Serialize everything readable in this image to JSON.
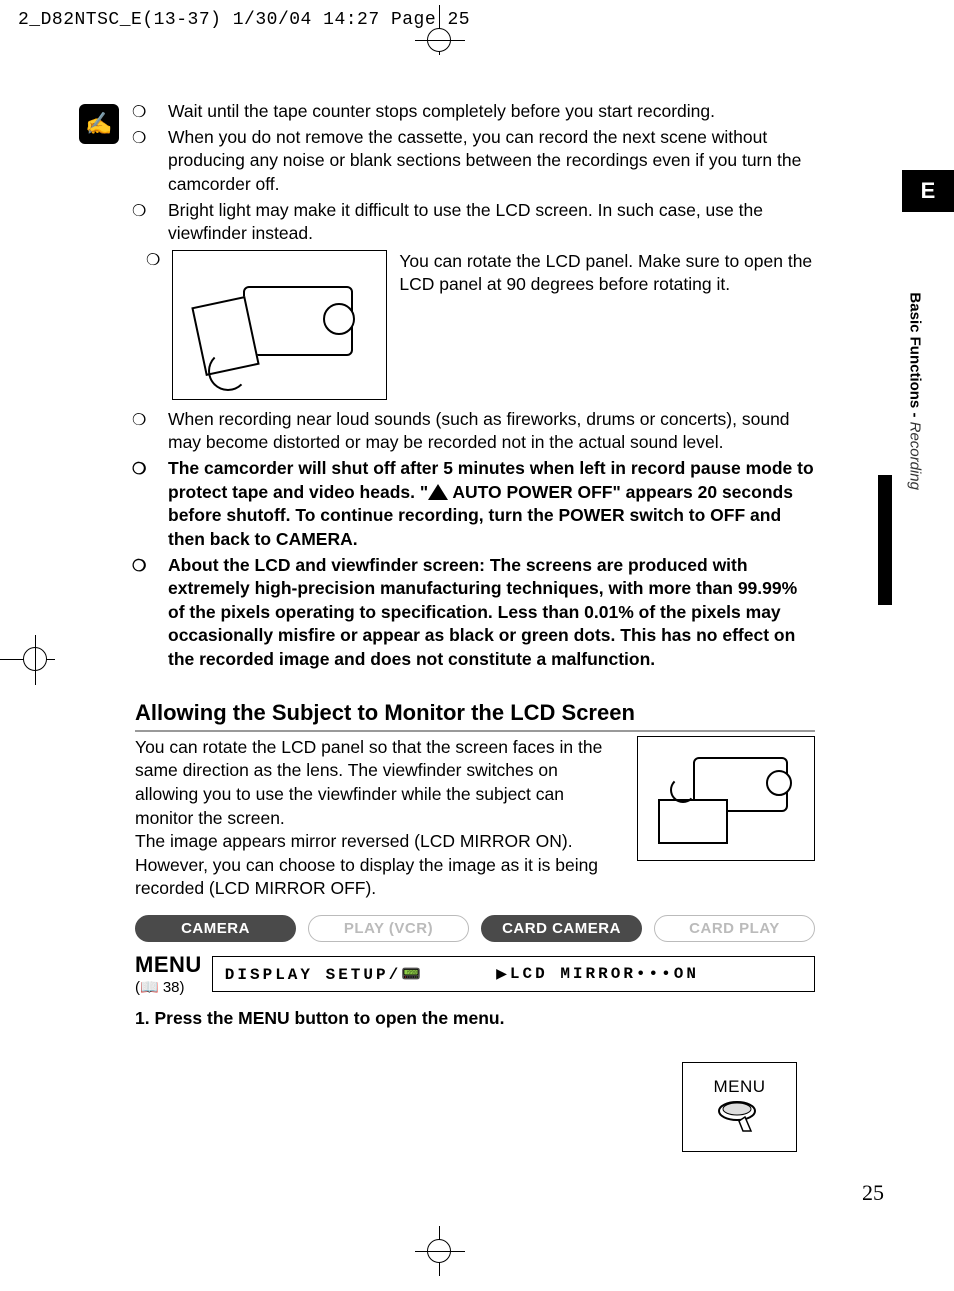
{
  "slug": "2_D82NTSC_E(13-37)  1/30/04 14:27  Page 25",
  "lang_tab": "E",
  "side_section_bold": "Basic Functions -",
  "side_section_italic": "Recording",
  "notes": {
    "bullet": "❍",
    "n1": "Wait until the tape counter stops completely before you start recording.",
    "n2": "When you do not remove the cassette, you can record the next scene without producing any noise or blank sections between the recordings even if you turn the camcorder off.",
    "n3": "Bright light may make it difficult to use the LCD screen. In such case, use the viewfinder instead.",
    "n4_caption": "You can rotate the LCD panel. Make sure to open the LCD panel at 90 degrees before rotating it.",
    "n5": "When recording near loud sounds (such as fireworks, drums or concerts), sound may become distorted or may be recorded not in the actual sound level.",
    "n6_bold_a": "The camcorder will shut off after 5 minutes when left in record pause mode to protect tape and video heads. \"",
    "n6_bold_b": "AUTO POWER OFF\" appears 20 seconds before shutoff. To continue recording, turn the POWER switch to OFF and then back to CAMERA.",
    "n7_bold": "About the LCD and viewfinder screen: The screens are produced with extremely high-precision manufacturing techniques, with more than 99.99% of the pixels operating to specification. Less than 0.01% of the pixels may occasionally misfire or appear as black or green dots. This has no effect on the recorded image and does not constitute a malfunction."
  },
  "section_title": "Allowing the Subject to Monitor the LCD Screen",
  "mirror_para": "You can rotate the LCD panel so that the screen faces in the same direction as the lens. The viewfinder switches on allowing you to use the viewfinder while the subject can monitor the screen.",
  "mirror_para2": "The image appears mirror reversed (LCD MIRROR ON). However, you can choose to display the image as it is being recorded (LCD MIRROR OFF).",
  "modes": {
    "camera": "CAMERA",
    "play": "PLAY (VCR)",
    "card_camera": "CARD CAMERA",
    "card_play": "CARD PLAY"
  },
  "menu": {
    "label": "MENU",
    "ref_prefix": "(📖 ",
    "ref_page": "38",
    "ref_suffix": ")",
    "path1": "DISPLAY SETUP/📟",
    "path2": "LCD MIRROR•••ON"
  },
  "step1": "1. Press the MENU button to open the menu.",
  "menu_fig_label": "MENU",
  "page_num": "25"
}
